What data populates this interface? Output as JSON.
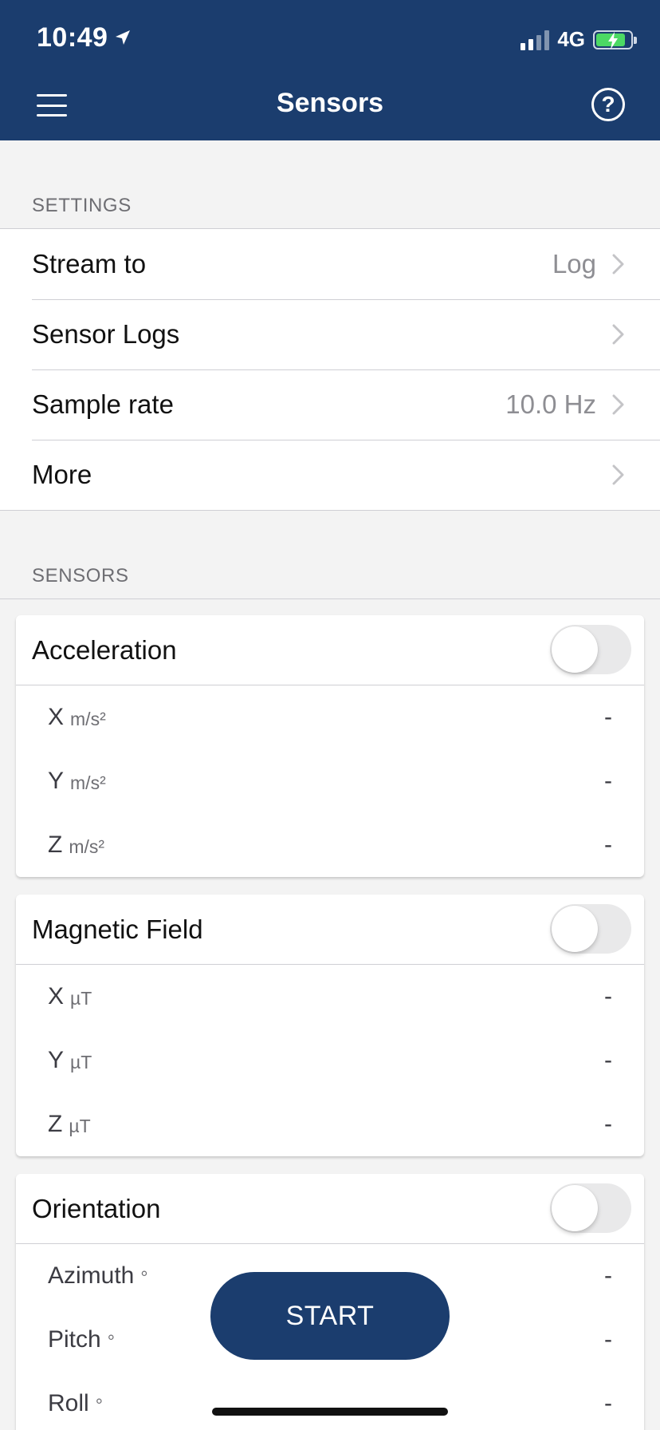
{
  "status_bar": {
    "time": "10:49",
    "network": "4G",
    "icons": [
      "location-arrow-icon",
      "signal-icon",
      "battery-charging-icon"
    ]
  },
  "header": {
    "title": "Sensors",
    "menu_icon": "hamburger-menu-icon",
    "help_icon": "help-icon",
    "help_glyph": "?",
    "accent_color": "#1b3d6e"
  },
  "settings": {
    "heading": "SETTINGS",
    "items": [
      {
        "label": "Stream to",
        "value": "Log"
      },
      {
        "label": "Sensor Logs",
        "value": ""
      },
      {
        "label": "Sample rate",
        "value": "10.0 Hz"
      },
      {
        "label": "More",
        "value": ""
      }
    ]
  },
  "sensors": {
    "heading": "SENSORS",
    "cards": [
      {
        "title": "Acceleration",
        "enabled": false,
        "axes": [
          {
            "name": "X",
            "unit": "m/s²",
            "value": "-"
          },
          {
            "name": "Y",
            "unit": "m/s²",
            "value": "-"
          },
          {
            "name": "Z",
            "unit": "m/s²",
            "value": "-"
          }
        ]
      },
      {
        "title": "Magnetic Field",
        "enabled": false,
        "axes": [
          {
            "name": "X",
            "unit": "µT",
            "value": "-"
          },
          {
            "name": "Y",
            "unit": "µT",
            "value": "-"
          },
          {
            "name": "Z",
            "unit": "µT",
            "value": "-"
          }
        ]
      },
      {
        "title": "Orientation",
        "enabled": false,
        "axes": [
          {
            "name": "Azimuth",
            "unit": "°",
            "value": "-"
          },
          {
            "name": "Pitch",
            "unit": "°",
            "value": "-"
          },
          {
            "name": "Roll",
            "unit": "°",
            "value": "-"
          }
        ]
      }
    ]
  },
  "start_button": {
    "label": "START"
  }
}
